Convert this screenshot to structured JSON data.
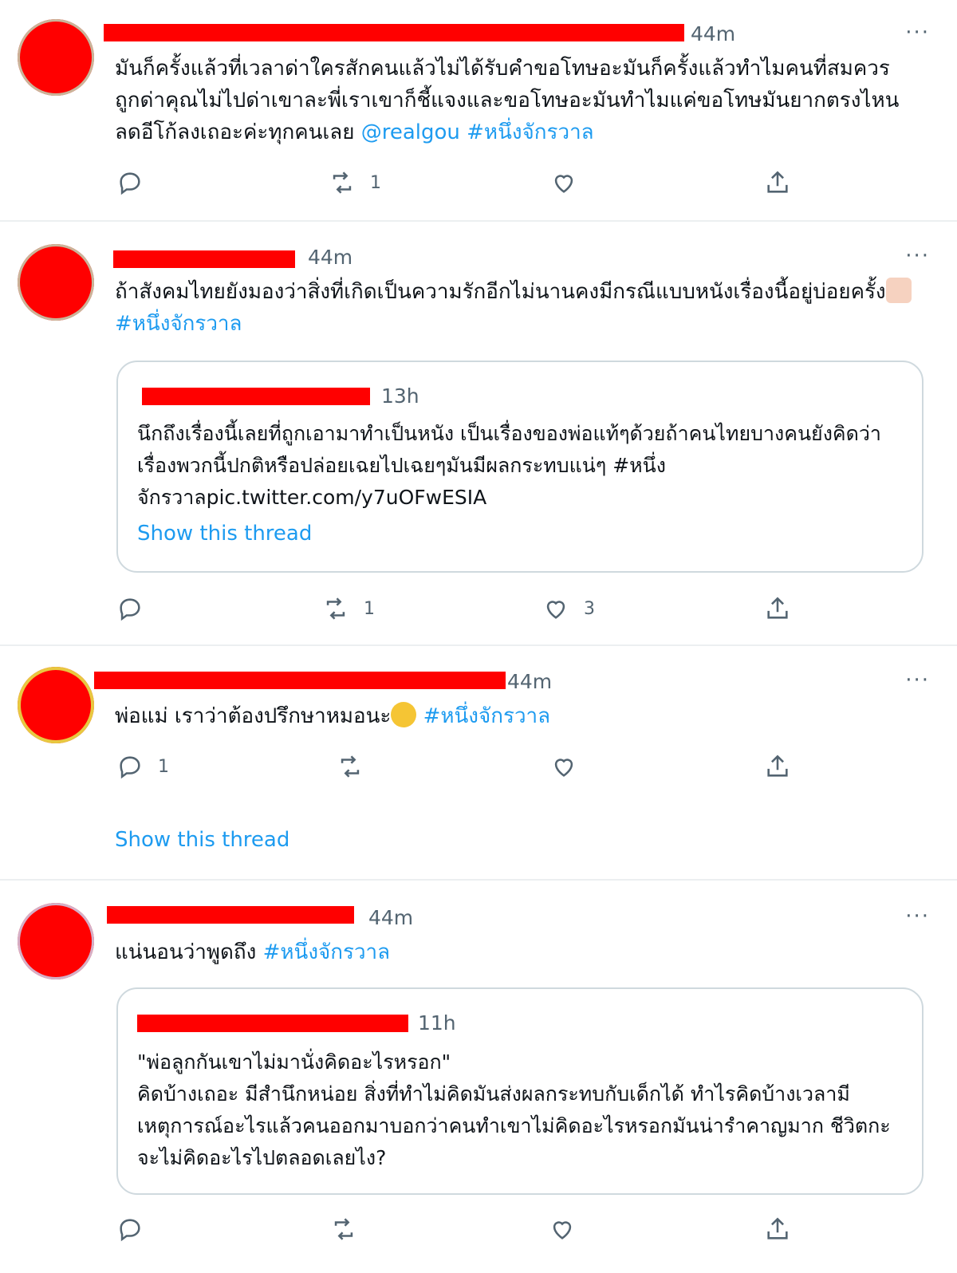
{
  "tweets": [
    {
      "time": "44m",
      "text": "มันก็ครั้งแล้วที่เวลาด่าใครสักคนแล้วไม่ได้รับคำขอโทษอะมันก็ครั้งแล้วทำไมคนที่สมควรถูกด่าคุณไม่ไปด่าเขาละพี่เราเขาก็ชี้แจงและขอโทษอะมันทำไมแค่ขอโทษมันยากตรงไหนลดอีโก้ลงเถอะค่ะทุกคนเลย ",
      "mention": "@realgou",
      "hashtag": "#หนึ่งจักรวาล",
      "reply_count": "",
      "retweet_count": "1",
      "like_count": ""
    },
    {
      "time": "44m",
      "text": "ถ้าสังคมไทยยังมองว่าสิ่งที่เกิดเป็นความรักอีกไม่นานคงมีกรณีแบบหนังเรื่องนี้อยู่บ่อยครั้ง",
      "hashtag": "#หนึ่งจักรวาล",
      "quote": {
        "time": "13h",
        "text": "นึกถึงเรื่องนี้เลยที่ถูกเอามาทำเป็นหนัง เป็นเรื่องของพ่อแท้ๆด้วยถ้าคนไทยบางคนยังคิดว่าเรื่องพวกนี้ปกติหรือปล่อยเฉยไปเฉยๆมันมีผลกระทบแน่ๆ #หนึ่งจักรวาลpic.twitter.com/y7uOFwESIA",
        "show_thread": "Show this thread"
      },
      "reply_count": "",
      "retweet_count": "1",
      "like_count": "3"
    },
    {
      "time": "44m",
      "text": "พ่อแม่ เราว่าต้องปรึกษาหมอนะ",
      "hashtag": "#หนึ่งจักรวาล",
      "reply_count": "1",
      "retweet_count": "",
      "like_count": "",
      "show_thread": "Show this thread"
    },
    {
      "time": "44m",
      "text": "แน่นอนว่าพูดถึง ",
      "hashtag": "#หนึ่งจักรวาล",
      "quote": {
        "time": "11h",
        "line1": "\"พ่อลูกกันเขาไม่มานั่งคิดอะไรหรอก\"",
        "text": "คิดบ้างเถอะ มีสำนึกหน่อย สิ่งที่ทำไม่คิดมันส่งผลกระทบกับเด็กได้ ทำไรคิดบ้างเวลามีเหตุการณ์อะไรแล้วคนออกมาบอกว่าคนทำเขาไม่คิดอะไรหรอกมันน่ารำคาญมาก ชีวิตกะจะไม่คิดอะไรไปตลอดเลยไง?"
      },
      "reply_count": "",
      "retweet_count": "",
      "like_count": ""
    }
  ],
  "colors": {
    "link": "#1d9bf0",
    "muted": "#536471",
    "redaction": "#ff0000"
  },
  "icons": [
    "reply-icon",
    "retweet-icon",
    "like-icon",
    "share-icon",
    "more-icon"
  ]
}
